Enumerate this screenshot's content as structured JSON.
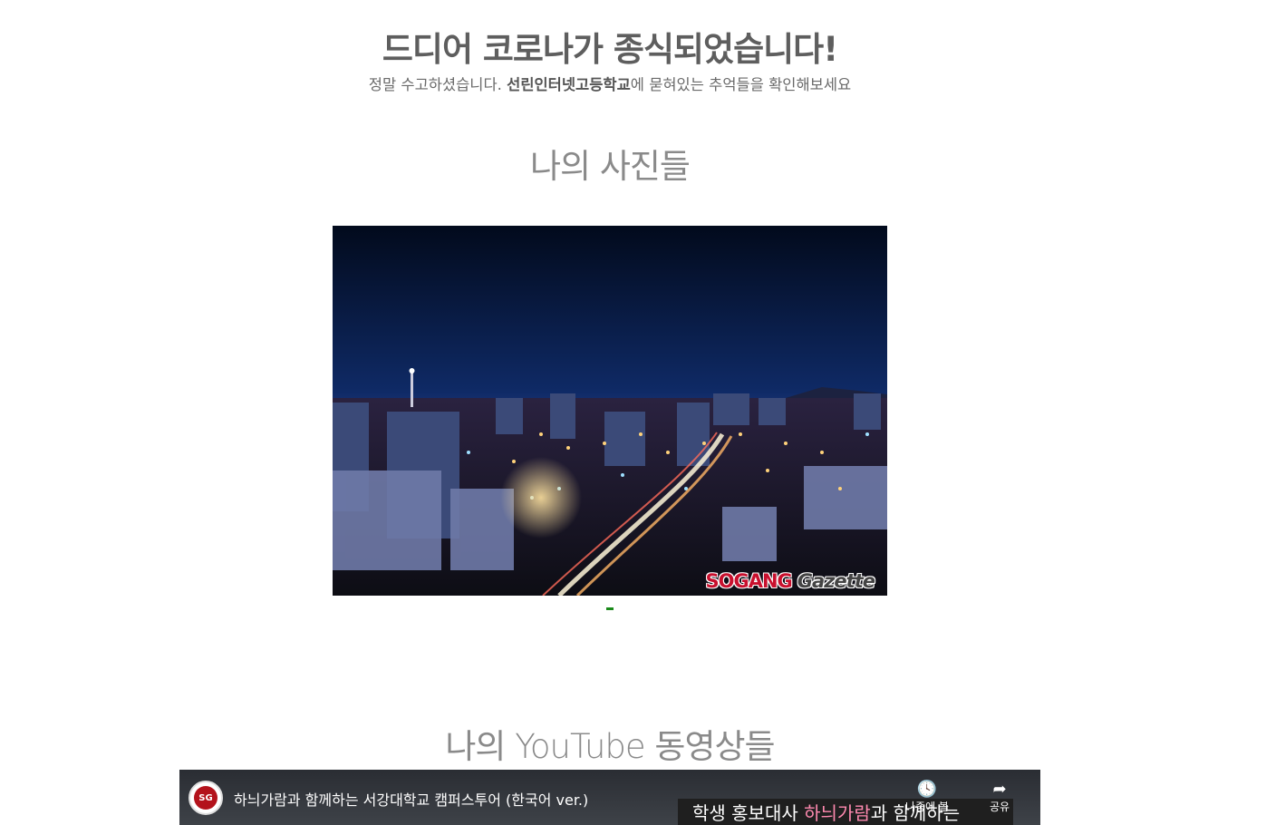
{
  "hero": {
    "title": "드디어 코로나가 종식되었습니다!",
    "subtitle_pre": "정말 수고하셨습니다. ",
    "subtitle_school": "선린인터넷고등학교",
    "subtitle_post": "에 묻혀있는 추억들을 확인해보세요"
  },
  "photos": {
    "section_title": "나의 사진들",
    "watermark_main": "SOGANG",
    "watermark_sub": "Gazette",
    "slide_count": 1,
    "active_slide": 1
  },
  "videos": {
    "section_title": "나의 YouTube 동영상들",
    "video_title": "하늬가람과 함께하는 서강대학교 캠퍼스투어 (한국어 ver.)",
    "channel_logo_text": "SG",
    "banner_text_pre": "학생 홍보대사 ",
    "banner_text_highlight": "하늬가람",
    "banner_text_post": "과 함께하는",
    "watch_later_label": "나중에 볼",
    "share_label": "공유"
  },
  "colors": {
    "accent_dot": "#1a8a1a",
    "watermark_red": "#c8102e"
  }
}
